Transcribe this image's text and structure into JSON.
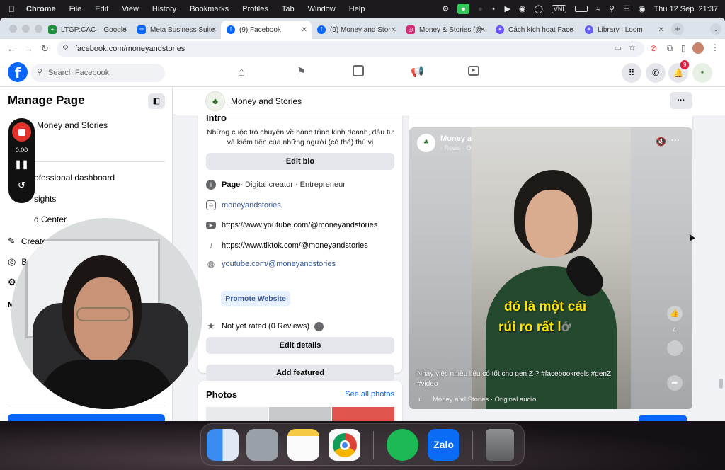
{
  "menubar": {
    "app": "Chrome",
    "items": [
      "File",
      "Edit",
      "View",
      "History",
      "Bookmarks",
      "Profiles",
      "Tab",
      "Window",
      "Help"
    ],
    "lang": "VNI",
    "datetime": "Thu 12 Sep  21:37"
  },
  "browser": {
    "tabs": [
      {
        "title": "LTGP:CAC – Google",
        "color": "#1e8e3e"
      },
      {
        "title": "Meta Business Suite",
        "color": "#0866ff"
      },
      {
        "title": "(9) Facebook",
        "color": "#0866ff"
      },
      {
        "title": "(9) Money and Stor",
        "color": "#0866ff"
      },
      {
        "title": "Money & Stories (@",
        "color": "#d62976"
      },
      {
        "title": "Cách kích hoạt Face",
        "color": "#6b52ff"
      },
      {
        "title": "Library | Loom",
        "color": "#625df5"
      }
    ],
    "url": "facebook.com/moneyandstories"
  },
  "fbnav": {
    "search_placeholder": "Search Facebook",
    "notification_count": "9"
  },
  "sidebar": {
    "title": "Manage Page",
    "page_name": "Money and Stories",
    "items": [
      "Professional dashboard",
      "Insights",
      "Ad Center",
      "Create ads",
      "Boost"
    ],
    "professional_visible": "ofessional dashboard",
    "insights_visible": "sights",
    "adcenter_visible": "d Center",
    "boost_visible": "Boos",
    "m_letter": "M"
  },
  "recorder": {
    "time": "0:00"
  },
  "header": {
    "page_name": "Money and Stories",
    "more": "···"
  },
  "intro": {
    "title": "Intro",
    "bio": "Những cuộc trò chuyện về hành trình kinh doanh, đầu tư và kiếm tiền của những người (có thể) thú vị",
    "edit_bio": "Edit bio",
    "category_label": "Page",
    "category_rest": " · Digital creator · Entrepreneur",
    "instagram": "moneyandstories",
    "youtube": "https://www.youtube.com/@moneyandstories",
    "tiktok": "https://www.tiktok.com/@moneyandstories",
    "website": "youtube.com/@moneyandstories",
    "promote": "Promote Website",
    "rating": "Not yet rated (0 Reviews)",
    "edit_details": "Edit details",
    "add_featured": "Add featured"
  },
  "photos": {
    "title": "Photos",
    "see_all": "See all photos"
  },
  "reel": {
    "page_name": "Money and Stories",
    "meta": "· Reels · Oct 28 ·",
    "caption_line1": "đó là một cái",
    "caption_line2": "rủi ro rất l",
    "caption_line2_faded": "ớ",
    "description": "Nhảy việc nhiều liệu có tốt cho gen Z ? #facebookreels #genZ #video",
    "audio": "Money and Stories · Original audio",
    "like_count": "4"
  },
  "dock": [
    "Finder",
    "Launchpad",
    "Notes",
    "Chrome",
    "Spotify",
    "Zalo",
    "Trash"
  ],
  "zalo_label": "Zalo",
  "colors": {
    "fb_blue": "#0866ff",
    "link": "#385898",
    "recorder_red": "#e0312a"
  }
}
